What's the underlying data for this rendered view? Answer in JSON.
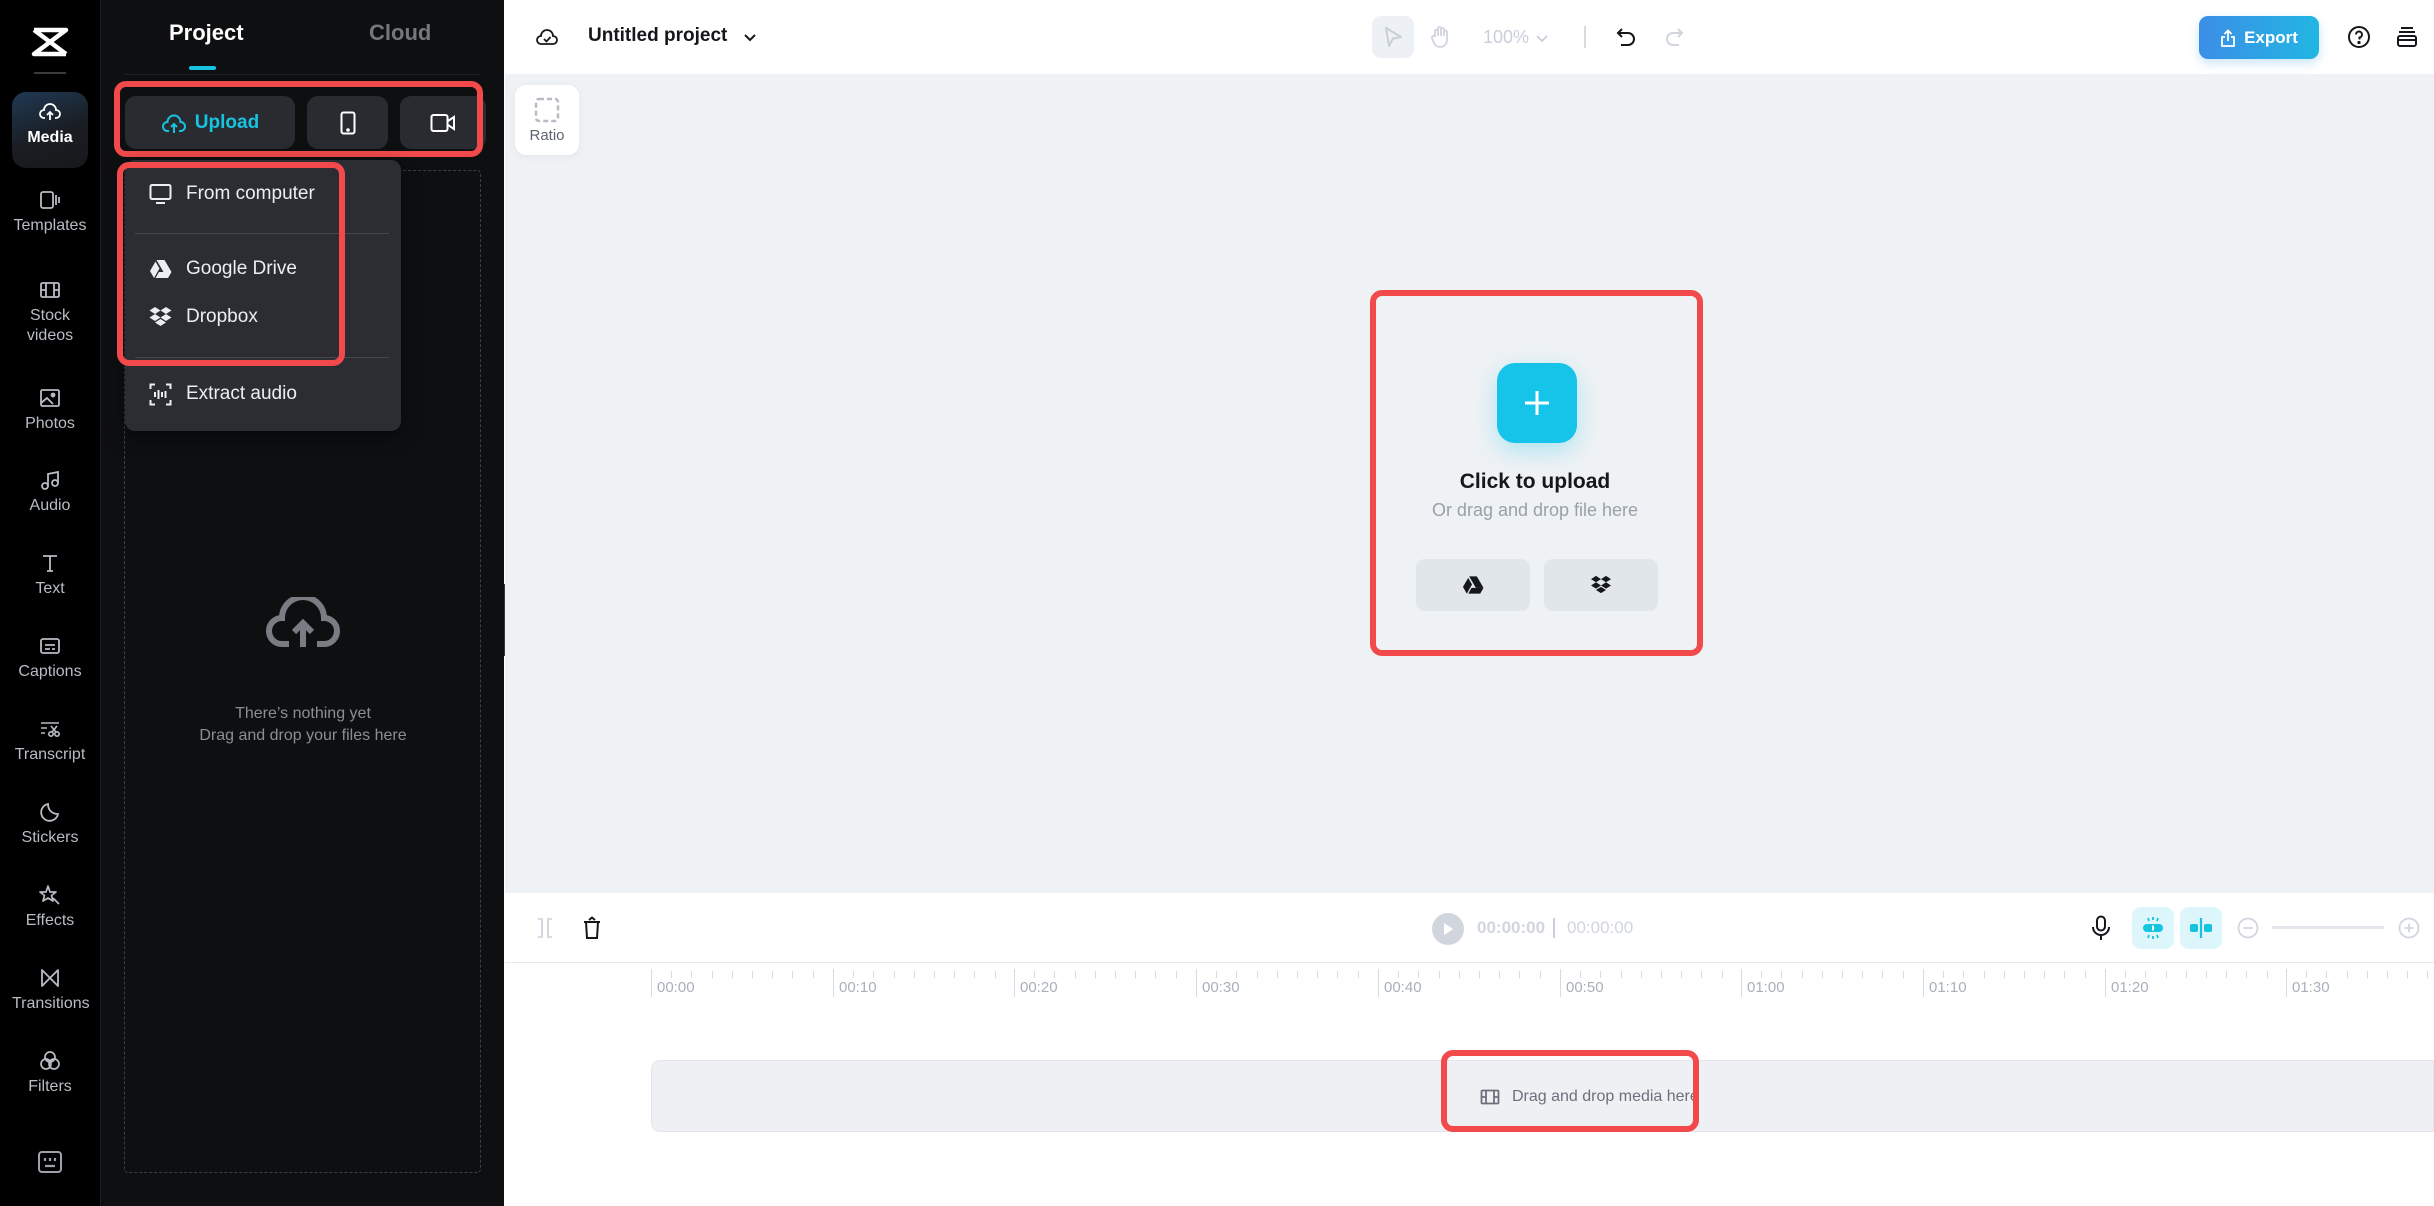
{
  "rail": {
    "items": [
      {
        "label": "Media",
        "icon": "cloud-upload-icon",
        "active": true
      },
      {
        "label": "Templates",
        "icon": "templates-icon"
      },
      {
        "label": "Stock videos",
        "icon": "film-icon"
      },
      {
        "label": "Photos",
        "icon": "image-icon"
      },
      {
        "label": "Audio",
        "icon": "music-note-icon"
      },
      {
        "label": "Text",
        "icon": "text-icon"
      },
      {
        "label": "Captions",
        "icon": "captions-icon"
      },
      {
        "label": "Transcript",
        "icon": "transcript-icon"
      },
      {
        "label": "Stickers",
        "icon": "sticker-icon"
      },
      {
        "label": "Effects",
        "icon": "effects-star-icon"
      },
      {
        "label": "Transitions",
        "icon": "transitions-icon"
      },
      {
        "label": "Filters",
        "icon": "filters-icon"
      }
    ],
    "keyboard_icon": "keyboard-icon"
  },
  "panel": {
    "tabs": [
      {
        "label": "Project",
        "active": true
      },
      {
        "label": "Cloud",
        "active": false
      }
    ],
    "upload_label": "Upload",
    "phone_icon": "phone-icon",
    "camera_icon": "video-camera-icon",
    "dropdown": [
      {
        "label": "From computer",
        "icon": "monitor-icon"
      },
      {
        "label": "Google Drive",
        "icon": "google-drive-icon"
      },
      {
        "label": "Dropbox",
        "icon": "dropbox-icon"
      },
      {
        "label": "Extract audio",
        "icon": "extract-audio-icon"
      }
    ],
    "empty_line1": "There’s nothing yet",
    "empty_line2": "Drag and drop your files here"
  },
  "header": {
    "project_title": "Untitled project",
    "zoom_level": "100%",
    "export_label": "Export",
    "accent_color": "#16c3e0"
  },
  "canvas": {
    "ratio_label": "Ratio",
    "click_to_upload": "Click to upload",
    "drag_file_hint": "Or drag and drop file here"
  },
  "timeline": {
    "current_time": "00:00:00",
    "total_time": "00:00:00",
    "ruler_labels": [
      "00:00",
      "00:10",
      "00:20",
      "00:30",
      "00:40",
      "00:50",
      "01:00",
      "01:10",
      "01:20",
      "01:30"
    ],
    "track_hint": "Drag and drop media here"
  }
}
